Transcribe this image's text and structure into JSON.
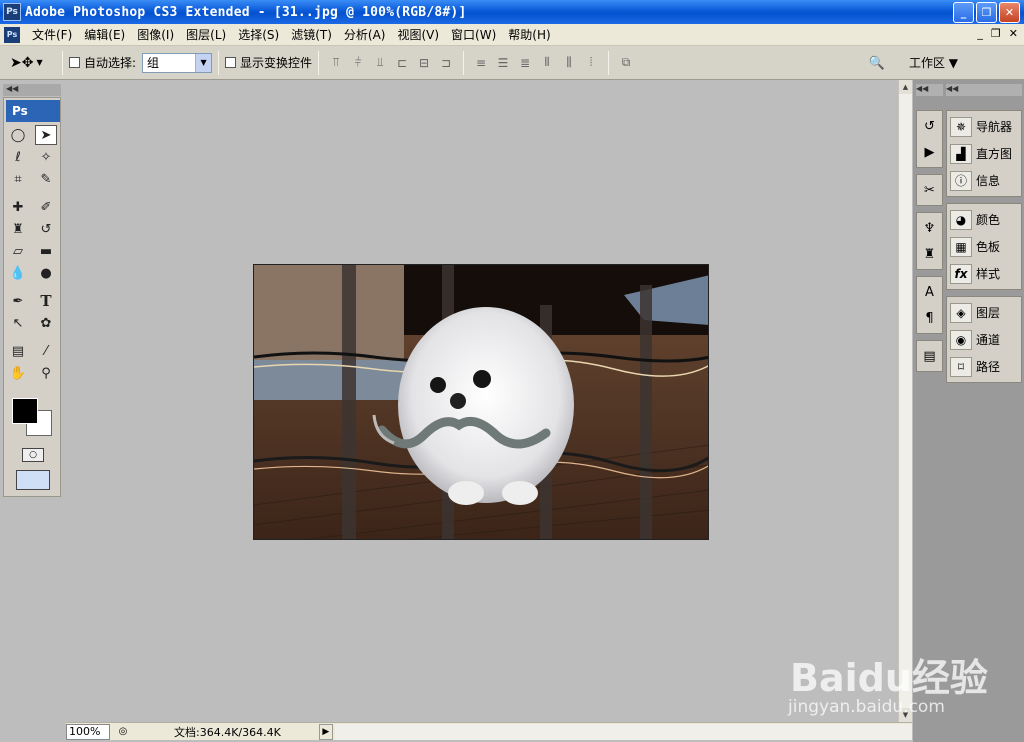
{
  "window": {
    "title": "Adobe Photoshop CS3 Extended - [31..jpg @ 100%(RGB/8#)]",
    "logo": "Ps",
    "controls": {
      "minimize": "_",
      "restore": "❐",
      "close": "✕"
    }
  },
  "menubar": {
    "items": [
      "文件(F)",
      "编辑(E)",
      "图像(I)",
      "图层(L)",
      "选择(S)",
      "滤镜(T)",
      "分析(A)",
      "视图(V)",
      "窗口(W)",
      "帮助(H)"
    ],
    "doc_controls": [
      "_",
      "❐",
      "✕"
    ]
  },
  "options": {
    "auto_select_label": "自动选择:",
    "auto_select_value": "组",
    "show_transform_label": "显示变换控件",
    "workspace_label": "工作区 ▼"
  },
  "tools": {
    "header": "Ps",
    "icons": [
      "marquee-icon",
      "move-icon",
      "lasso-icon",
      "magic-wand-icon",
      "crop-icon",
      "slice-icon",
      "healing-brush-icon",
      "brush-icon",
      "clone-stamp-icon",
      "history-brush-icon",
      "eraser-icon",
      "gradient-icon",
      "blur-icon",
      "dodge-icon",
      "pen-icon",
      "type-icon",
      "path-select-icon",
      "shape-icon",
      "notes-icon",
      "eyedropper-icon",
      "hand-icon",
      "zoom-icon"
    ],
    "foreground_color": "#000000",
    "background_color": "#ffffff"
  },
  "dock": {
    "panels": [
      {
        "group": 1,
        "items": [
          "导航器",
          "直方图",
          "信息"
        ]
      },
      {
        "group": 2,
        "items": [
          "颜色",
          "色板",
          "样式"
        ]
      },
      {
        "group": 3,
        "items": [
          "图层",
          "通道",
          "路径"
        ]
      }
    ]
  },
  "status": {
    "zoom": "100%",
    "doc_size": "文档:364.4K/364.4K"
  },
  "watermark": {
    "logo": "Baidu经验",
    "url": "jingyan.baidu.com"
  },
  "colors": {
    "titlebar": "#0a5ad8",
    "workspace_bg": "#bdbdbd",
    "panel_bg": "#d4d0c8"
  }
}
